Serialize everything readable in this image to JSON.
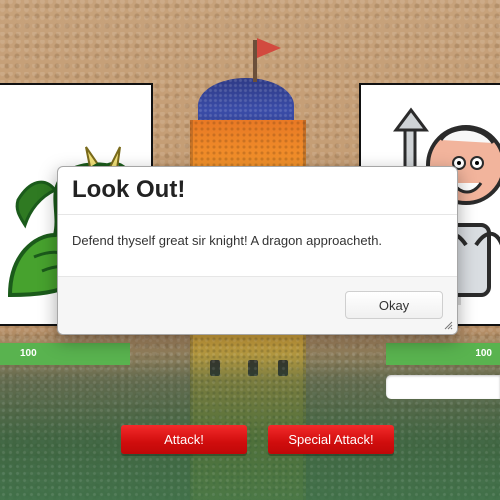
{
  "modal": {
    "title": "Look Out!",
    "message": "Defend thyself great sir knight! A dragon approacheth.",
    "okay_label": "Okay"
  },
  "player_left": {
    "character_icon": "dragon-icon",
    "hp_value": "100",
    "hp_color": "#59b34f"
  },
  "player_right": {
    "character_icon": "knight-icon",
    "hp_value": "100",
    "hp_color": "#59b34f"
  },
  "actions": {
    "attack_label": "Attack!",
    "special_attack_label": "Special Attack!",
    "button_color": "#e01414"
  },
  "background": {
    "scene_icon": "castle-tapestry-icon",
    "flag_color": "#d24a3f"
  }
}
